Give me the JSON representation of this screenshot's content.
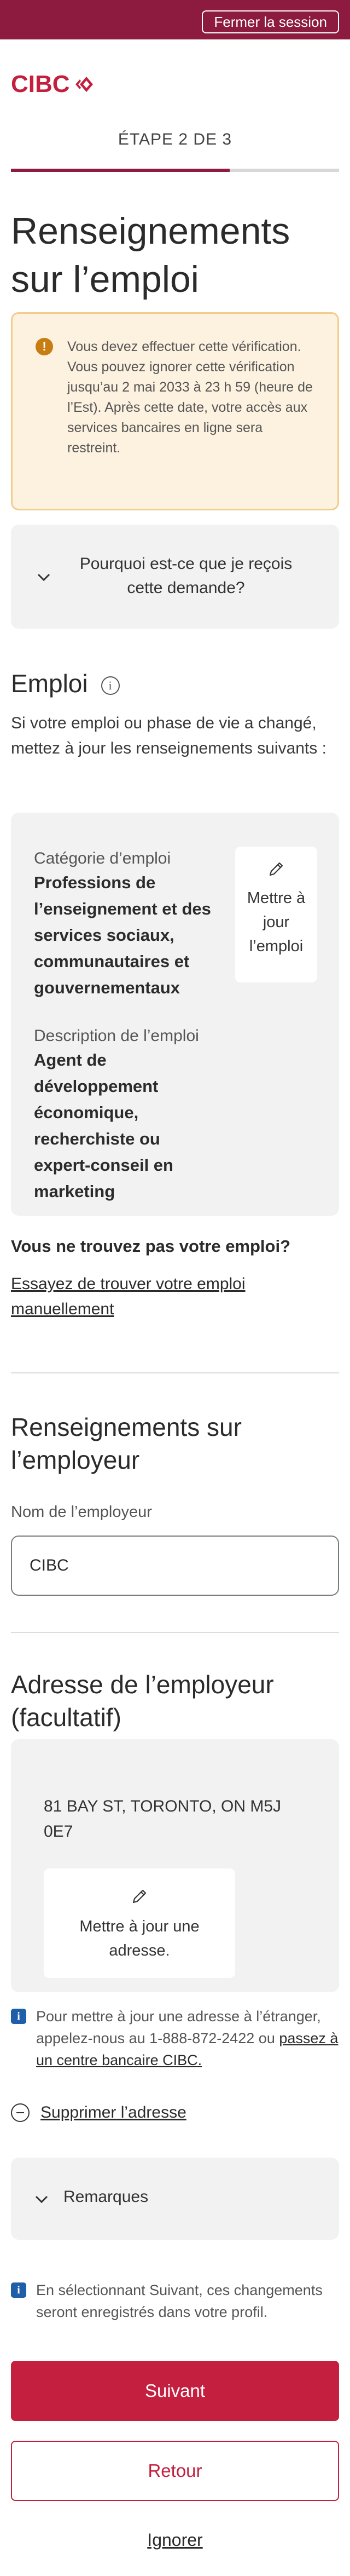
{
  "header": {
    "logout_label": "Fermer la session"
  },
  "brand": {
    "logo_text": "CIBC",
    "colors": {
      "header_bg": "#8c1b3f",
      "brand_red": "#c41f3e"
    }
  },
  "progress": {
    "step_label": "ÉTAPE 2 DE 3",
    "fraction": 0.667
  },
  "page_title": "Renseignements sur l’emploi",
  "alert": {
    "icon": "exclamation-icon",
    "text": "Vous devez effectuer cette vérification. Vous pouvez ignorer cette vérification jusqu’au 2 mai 2033 à 23 h 59 (heure de l’Est). Après cette date, votre accès aux services bancaires en ligne sera restreint."
  },
  "why": {
    "label": "Pourquoi est-ce que je reçois cette demande?"
  },
  "employment": {
    "heading": "Emploi",
    "intro": "Si votre emploi ou phase de vie a changé, mettez à jour les renseignements suivants :",
    "category_label": "Catégorie d’emploi",
    "category_value": "Professions de l’enseignement et des services sociaux, communautaires et gouvernementaux",
    "update_label": "Mettre à jour l’emploi",
    "description_label": "Description de l’emploi",
    "description_value": "Agent de développement économique, recherchiste ou expert-conseil en marketing",
    "not_found_label": "Vous ne trouvez pas votre emploi?",
    "manual_link": "Essayez de trouver votre emploi manuellement"
  },
  "employer": {
    "heading": "Renseignements sur l’employeur",
    "name_label": "Nom de l’employeur",
    "name_value": "CIBC"
  },
  "address": {
    "heading": "Adresse de l’employeur (facultatif)",
    "value": "81 BAY ST, TORONTO, ON M5J 0E7",
    "update_label": "Mettre à jour une adresse.",
    "foreign_note": "Pour mettre à jour une adresse à l’étranger, appelez-nous au 1-888-872-2422 ou ",
    "foreign_link": "passez à un centre bancaire CIBC.",
    "remove_label": "Supprimer l’adresse"
  },
  "remarks": {
    "label": "Remarques"
  },
  "save_note": "En sélectionnant Suivant, ces changements seront enregistrés dans votre profil.",
  "actions": {
    "next": "Suivant",
    "back": "Retour",
    "ignore": "Ignorer"
  }
}
